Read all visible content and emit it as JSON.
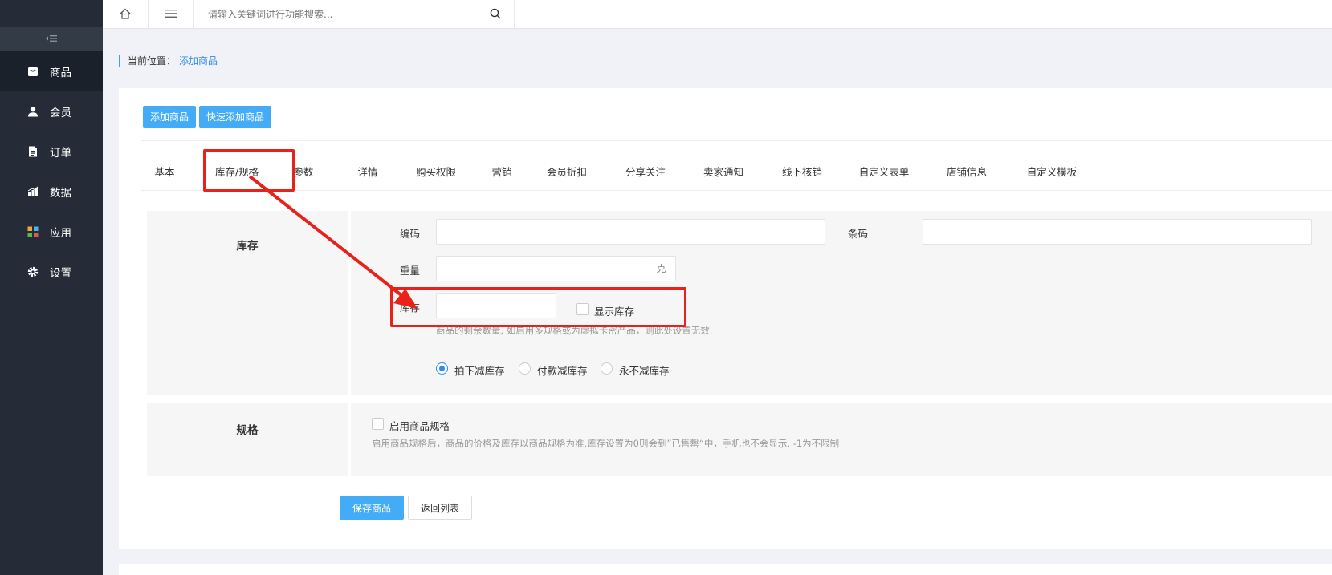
{
  "sidebar": {
    "collapse_icon": "collapse-icon",
    "items": [
      {
        "label": "商品",
        "icon": "bag-icon"
      },
      {
        "label": "会员",
        "icon": "user-icon"
      },
      {
        "label": "订单",
        "icon": "document-icon"
      },
      {
        "label": "数据",
        "icon": "chart-icon"
      },
      {
        "label": "应用",
        "icon": "apps-icon"
      },
      {
        "label": "设置",
        "icon": "gear-icon"
      }
    ]
  },
  "topbar": {
    "search_placeholder": "请输入关键词进行功能搜索..."
  },
  "breadcrumb": {
    "prefix": "当前位置：",
    "current": "添加商品"
  },
  "actions": {
    "add_goods": "添加商品",
    "quick_add_goods": "快速添加商品"
  },
  "tabs": [
    "基本",
    "库存/规格",
    "参数",
    "详情",
    "购买权限",
    "营销",
    "会员折扣",
    "分享关注",
    "卖家通知",
    "线下核销",
    "自定义表单",
    "店铺信息",
    "自定义模板"
  ],
  "stock_section": {
    "title": "库存",
    "code_label": "编码",
    "barcode_label": "条码",
    "weight_label": "重量",
    "weight_unit": "克",
    "stock_label": "库存",
    "show_stock_label": "显示库存",
    "stock_help": "商品的剩余数量, 如启用多规格或为虚拟卡密产品，则此处设置无效.",
    "reduce_options": [
      "拍下减库存",
      "付款减库存",
      "永不减库存"
    ]
  },
  "spec_section": {
    "title": "规格",
    "enable_label": "启用商品规格",
    "help": "启用商品规格后，商品的价格及库存以商品规格为准,库存设置为0则会到”已售罄“中，手机也不会显示, -1为不限制"
  },
  "footer": {
    "save": "保存商品",
    "back": "返回列表"
  },
  "colors": {
    "sidebar_bg": "#252c37",
    "accent": "#44abf7",
    "annotation": "#e8221b"
  }
}
